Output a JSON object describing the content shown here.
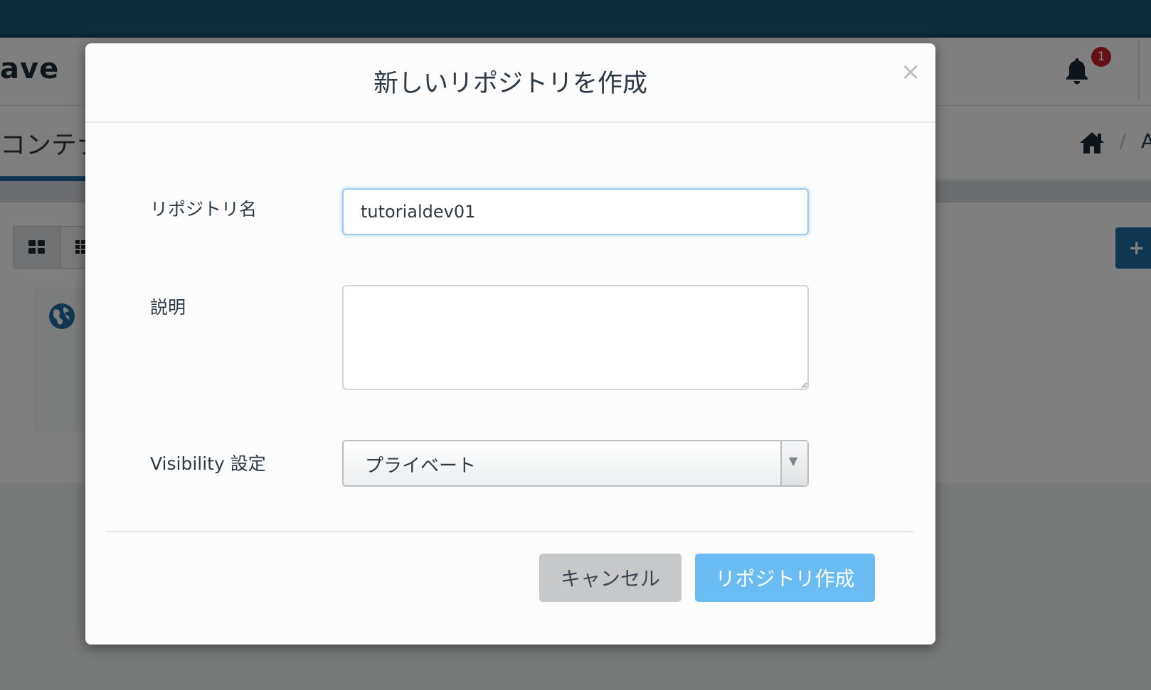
{
  "app": {
    "brand_partial": "ave",
    "notification_count": "1",
    "page_title_partial": "コンテナ",
    "breadcrumb_separator": "/",
    "breadcrumb_next_partial": "A",
    "add_button_partial": "+"
  },
  "modal": {
    "title": "新しいリポジトリを作成",
    "close_symbol": "×",
    "fields": {
      "name_label": "リポジトリ名",
      "name_value": "tutorialdev01",
      "description_label": "説明",
      "description_value": "",
      "visibility_label": "Visibility 設定",
      "visibility_selected": "プライベート"
    },
    "buttons": {
      "cancel": "キャンセル",
      "create": "リポジトリ作成"
    }
  },
  "colors": {
    "topbar": "#1f5977",
    "accent": "#1f6fa3",
    "create_button": "#6bbcf2",
    "cancel_button": "#c6c8ca",
    "badge": "#c7202f"
  }
}
